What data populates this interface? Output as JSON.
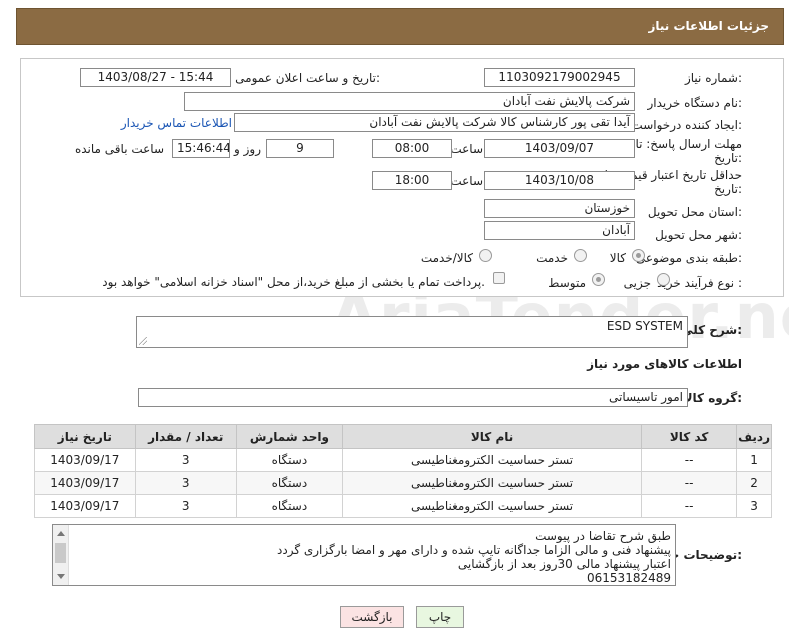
{
  "header": {
    "title": "جزئیات اطلاعات نیاز"
  },
  "form": {
    "need_number_label": "شماره نیاز:",
    "need_number": "1103092179002945",
    "announce_label": "تاریخ و ساعت اعلان عمومی:",
    "announce_value": "1403/08/27 - 15:44",
    "buyer_org_label": "نام دستگاه خریدار:",
    "buyer_org": "شرکت پالایش نفت آبادان",
    "creator_label": "ایجاد کننده درخواست:",
    "creator": "آیدا تقی پور کارشناس کالا شرکت پالایش نفت آبادان",
    "contact_link": "اطلاعات تماس خریدار",
    "deadline_label": "مهلت ارسال پاسخ: تا تاریخ:",
    "deadline_date": "1403/09/07",
    "time_label": "ساعت",
    "deadline_time": "08:00",
    "days_value": "9",
    "days_label": "روز و",
    "remaining_time": "15:46:44",
    "remaining_label": "ساعت باقی مانده",
    "validity_label": "حداقل تاریخ اعتبار قیمت: تا تاریخ:",
    "validity_date": "1403/10/08",
    "validity_time_label": "ساعت",
    "validity_time": "18:00",
    "province_label": "استان محل تحویل:",
    "province": "خوزستان",
    "city_label": "شهر محل تحویل:",
    "city": "آبادان",
    "category_label": "طبقه بندی موضوعی:",
    "category_options": [
      "کالا",
      "خدمت",
      "کالا/خدمت"
    ],
    "process_label": "نوع فرآیند خرید :",
    "process_options": [
      "جزیی",
      "متوسط"
    ],
    "payment_note": "پرداخت تمام یا بخشی از مبلغ خرید،از محل \"اسناد خزانه اسلامی\" خواهد بود."
  },
  "summary": {
    "label": "شرح کلی نیاز:",
    "value": "ESD SYSTEM"
  },
  "items_section": {
    "title": "اطلاعات کالاهای مورد نیاز",
    "group_label": "گروه کالا:",
    "group_value": "امور تاسیساتی"
  },
  "table": {
    "headers": [
      "ردیف",
      "کد کالا",
      "نام کالا",
      "واحد شمارش",
      "تعداد / مقدار",
      "تاریخ نیاز"
    ],
    "rows": [
      [
        "1",
        "--",
        "تستر حساسیت الکترومغناطیسی",
        "دستگاه",
        "3",
        "1403/09/17"
      ],
      [
        "2",
        "--",
        "تستر حساسیت الکترومغناطیسی",
        "دستگاه",
        "3",
        "1403/09/17"
      ],
      [
        "3",
        "--",
        "تستر حساسیت الکترومغناطیسی",
        "دستگاه",
        "3",
        "1403/09/17"
      ]
    ]
  },
  "notes": {
    "label": "توضیحات خریدار:",
    "lines": [
      "طبق شرح تقاضا در پیوست",
      "پیشنهاد فنی و مالی الزاما جداگانه تایپ شده و دارای مهر و امضا بارگزاری گردد",
      "اعتبار پیشنهاد مالی 30روز بعد از بازگشایی",
      "06153182489"
    ]
  },
  "buttons": {
    "print": "چاپ",
    "back": "بازگشت"
  },
  "watermark": "AriaTender.net"
}
